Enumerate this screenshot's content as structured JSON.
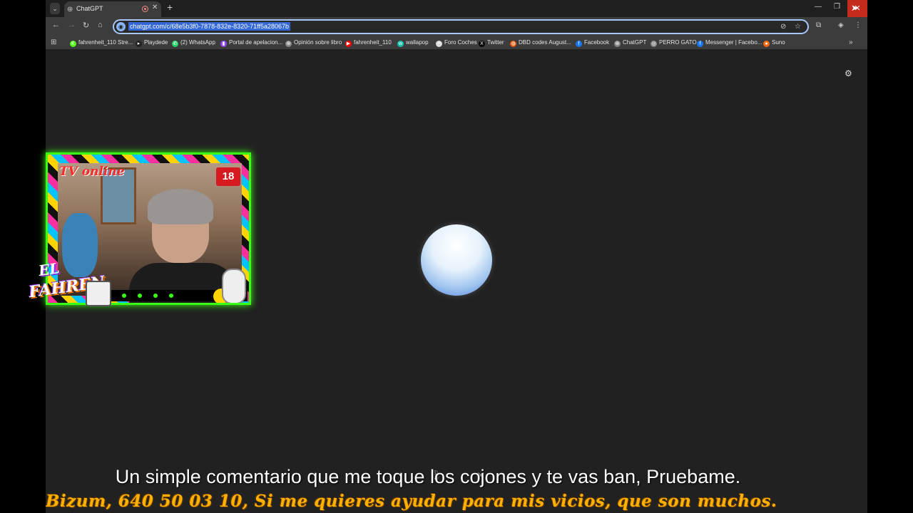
{
  "browser": {
    "tab_title": "ChatGPT",
    "url": "chatgpt.com/c/68e5b3f0-7878-832e-8320-71ff5a28067b"
  },
  "bookmarks": [
    {
      "label": "fahrenheit_110 Stre...",
      "icon": "kick-icon",
      "color": "#53fc18"
    },
    {
      "label": "Playdede",
      "icon": "playdede-icon",
      "color": "#222222"
    },
    {
      "label": "(2) WhatsApp",
      "icon": "whatsapp-icon",
      "color": "#25d366"
    },
    {
      "label": "Portal de apelacion...",
      "icon": "twitch-icon",
      "color": "#9146ff"
    },
    {
      "label": "Opinión sobre libro",
      "icon": "chatgpt-icon",
      "color": "#888888"
    },
    {
      "label": "fahrenheit_110",
      "icon": "youtube-icon",
      "color": "#ff0000"
    },
    {
      "label": "wallapop",
      "icon": "wallapop-icon",
      "color": "#13c1ac"
    },
    {
      "label": "Foro Coches",
      "icon": "forocoches-icon",
      "color": "#dddddd"
    },
    {
      "label": "Twitter",
      "icon": "x-icon",
      "color": "#000000"
    },
    {
      "label": "DBD codes August...",
      "icon": "dbd-icon",
      "color": "#e8590c"
    },
    {
      "label": "Facebook",
      "icon": "facebook-icon",
      "color": "#1877f2"
    },
    {
      "label": "ChatGPT",
      "icon": "chatgpt-icon",
      "color": "#888888"
    },
    {
      "label": "PERRO GATO",
      "icon": "globe-icon",
      "color": "#888888"
    },
    {
      "label": "Messenger | Facebo...",
      "icon": "facebook-icon",
      "color": "#1877f2"
    },
    {
      "label": "Suno",
      "icon": "suno-icon",
      "color": "#f76b15"
    }
  ],
  "overlay": {
    "tv_label": "TV online",
    "age_badge": "18",
    "logo_top": "EL",
    "logo_bottom": "FAHREN"
  },
  "subtitle": "Un simple comentario que me toque los cojones y te vas ban, Pruebame.",
  "ticker": "Bizum, 640 50 03 10,  Si me quieres ayudar para mis vicios, que son muchos."
}
